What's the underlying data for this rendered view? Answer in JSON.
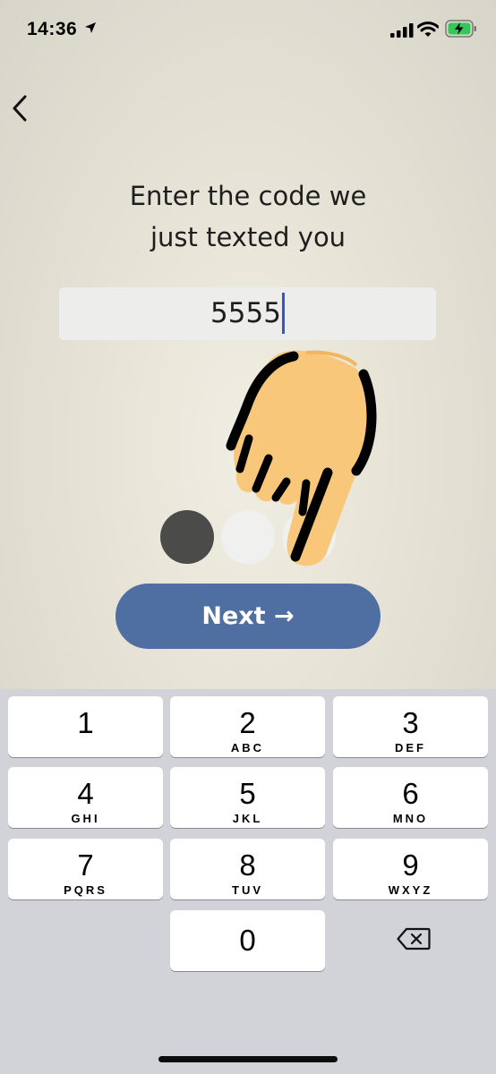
{
  "status_bar": {
    "time": "14:36"
  },
  "screen": {
    "title_line1": "Enter the code we",
    "title_line2": "just texted you",
    "code_value": "5555",
    "next_label": "Next →",
    "progress": {
      "current_step": 1,
      "total_steps": 3
    }
  },
  "keypad": {
    "keys": [
      {
        "digit": "1",
        "letters": ""
      },
      {
        "digit": "2",
        "letters": "ABC"
      },
      {
        "digit": "3",
        "letters": "DEF"
      },
      {
        "digit": "4",
        "letters": "GHI"
      },
      {
        "digit": "5",
        "letters": "JKL"
      },
      {
        "digit": "6",
        "letters": "MNO"
      },
      {
        "digit": "7",
        "letters": "PQRS"
      },
      {
        "digit": "8",
        "letters": "TUV"
      },
      {
        "digit": "9",
        "letters": "WXYZ"
      },
      {
        "digit": "0",
        "letters": ""
      }
    ]
  },
  "colors": {
    "next_button": "#4f6ea1",
    "caret": "#2f56d8",
    "progress_active": "#4b4b4a",
    "progress_inactive": "#f0f0ee",
    "hand_fill": "#f8c77a",
    "keyboard_bg": "#d1d3d9"
  },
  "icons": [
    "location-arrow-icon",
    "signal-icon",
    "wifi-icon",
    "battery-charging-icon",
    "back-chevron-icon",
    "pointing-hand-icon",
    "delete-backspace-icon"
  ]
}
